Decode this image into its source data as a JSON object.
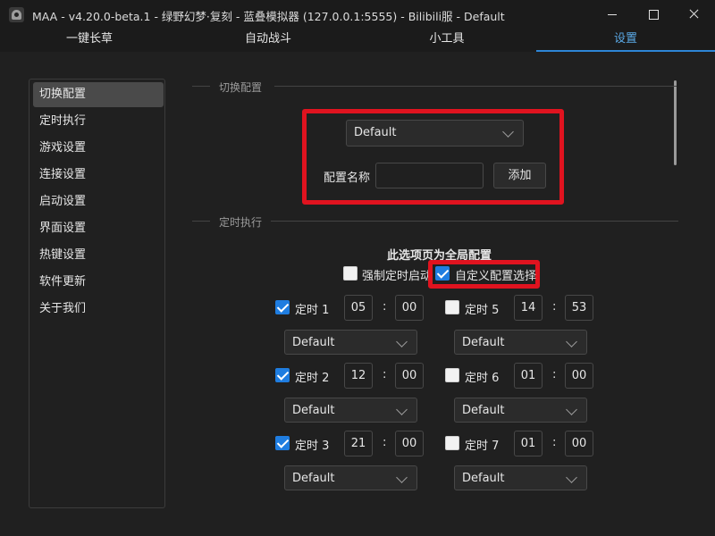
{
  "window": {
    "title": "MAA - v4.20.0-beta.1 - 绿野幻梦·复刻 - 蓝叠模拟器 (127.0.0.1:5555) - Bilibili服 - Default"
  },
  "tabs": [
    {
      "label": "一键长草",
      "active": false
    },
    {
      "label": "自动战斗",
      "active": false
    },
    {
      "label": "小工具",
      "active": false
    },
    {
      "label": "设置",
      "active": true
    }
  ],
  "sidebar": {
    "items": [
      {
        "label": "切换配置",
        "active": true
      },
      {
        "label": "定时执行",
        "active": false
      },
      {
        "label": "游戏设置",
        "active": false
      },
      {
        "label": "连接设置",
        "active": false
      },
      {
        "label": "启动设置",
        "active": false
      },
      {
        "label": "界面设置",
        "active": false
      },
      {
        "label": "热键设置",
        "active": false
      },
      {
        "label": "软件更新",
        "active": false
      },
      {
        "label": "关于我们",
        "active": false
      }
    ]
  },
  "profile_section": {
    "header": "切换配置",
    "selected_profile": "Default",
    "name_label": "配置名称",
    "name_value": "",
    "add_button": "添加"
  },
  "schedule_section": {
    "header": "定时执行",
    "global_note": "此选项页为全局配置",
    "force_start_label": "强制定时启动",
    "force_start_checked": false,
    "custom_config_label": "自定义配置选择",
    "custom_config_checked": true,
    "timers": [
      {
        "label": "定时 1",
        "checked": true,
        "hour": "05",
        "minute": "00",
        "profile": "Default"
      },
      {
        "label": "定时 2",
        "checked": true,
        "hour": "12",
        "minute": "00",
        "profile": "Default"
      },
      {
        "label": "定时 3",
        "checked": true,
        "hour": "21",
        "minute": "00",
        "profile": "Default"
      },
      {
        "label": "定时 5",
        "checked": false,
        "hour": "14",
        "minute": "53",
        "profile": "Default"
      },
      {
        "label": "定时 6",
        "checked": false,
        "hour": "01",
        "minute": "00",
        "profile": "Default"
      },
      {
        "label": "定时 7",
        "checked": false,
        "hour": "01",
        "minute": "00",
        "profile": "Default"
      }
    ]
  },
  "colors": {
    "accent": "#2d86d6",
    "highlight": "#e0131f"
  }
}
